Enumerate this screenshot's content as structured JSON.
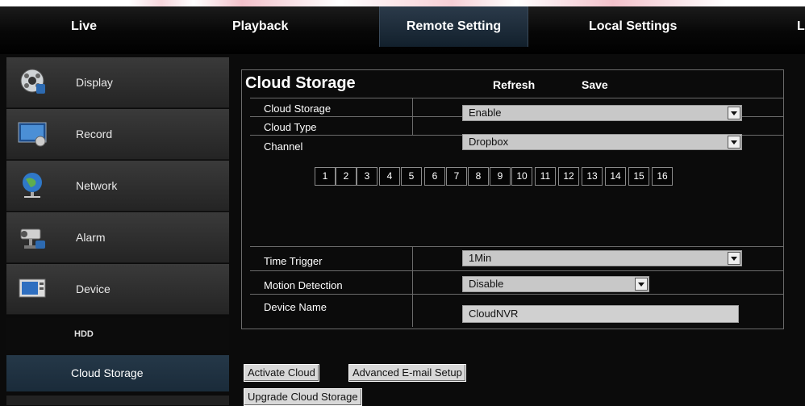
{
  "nav": {
    "live": "Live",
    "playback": "Playback",
    "remote_setting": "Remote Setting",
    "local_settings": "Local Settings",
    "truncated": "L"
  },
  "sidebar": {
    "items": [
      {
        "label": "Display",
        "icon": "display-icon"
      },
      {
        "label": "Record",
        "icon": "record-icon"
      },
      {
        "label": "Network",
        "icon": "network-icon"
      },
      {
        "label": "Alarm",
        "icon": "alarm-icon"
      },
      {
        "label": "Device",
        "icon": "device-icon"
      }
    ],
    "sub_hdd": "HDD",
    "sub_cloud_storage": "Cloud Storage"
  },
  "panel": {
    "title": "Cloud Storage",
    "refresh": "Refresh",
    "save": "Save"
  },
  "form": {
    "cloud_storage_label": "Cloud Storage",
    "cloud_storage_value": "Enable",
    "cloud_type_label": "Cloud Type",
    "cloud_type_value": "Dropbox",
    "channel_label": "Channel",
    "channels": [
      "1",
      "2",
      "3",
      "4",
      "5",
      "6",
      "7",
      "8",
      "9",
      "10",
      "11",
      "12",
      "13",
      "14",
      "15",
      "16"
    ],
    "time_trigger_label": "Time Trigger",
    "time_trigger_value": "1Min",
    "motion_detection_label": "Motion Detection",
    "motion_detection_value": "Disable",
    "device_name_label": "Device Name",
    "device_name_value": "CloudNVR"
  },
  "buttons": {
    "activate_cloud": "Activate Cloud",
    "advanced_email": "Advanced E-mail Setup",
    "upgrade_cloud": "Upgrade Cloud Storage"
  },
  "colors": {
    "active_tab": "#1f3142",
    "background": "#0b0b0b",
    "border": "#6b6b6b"
  }
}
